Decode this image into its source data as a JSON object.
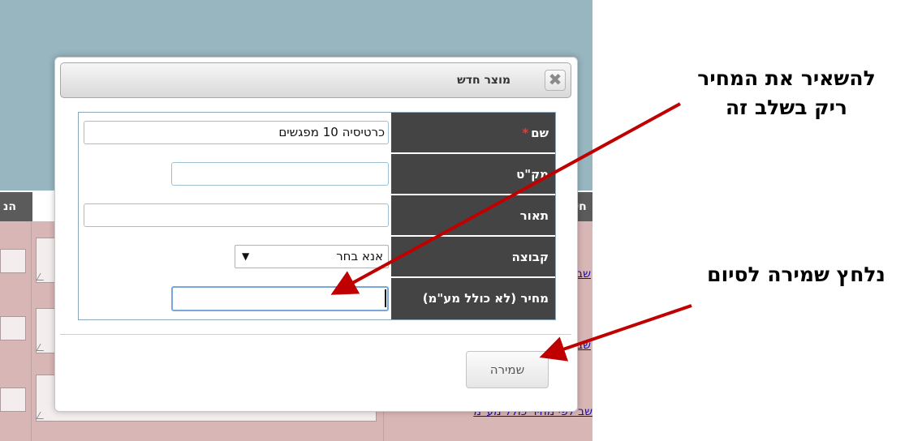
{
  "background": {
    "header_color": "#97b6c0",
    "table_color": "#d9b6b6",
    "column_header_left": "הנ",
    "column_header_right": "חי",
    "links": [
      "שב",
      "שב",
      "שב לפי מחיר כולל מע\"מ"
    ]
  },
  "dialog": {
    "title": "מוצר חדש",
    "close_icon": "close-icon",
    "fields": {
      "name": {
        "label": "שם",
        "required_mark": "*",
        "value": "כרטיסיה 10 מפגשים"
      },
      "sku": {
        "label": "מק\"ט",
        "value": ""
      },
      "description": {
        "label": "תאור",
        "value": ""
      },
      "group": {
        "label": "קבוצה",
        "selected": "אנא בחר",
        "arrow": "▼"
      },
      "price": {
        "label": "מחיר (לא כולל מע\"מ)",
        "value": ""
      }
    },
    "save_label": "שמירה"
  },
  "annotations": {
    "leave_price_empty_line1": "להשאיר את המחיר",
    "leave_price_empty_line2": "ריק בשלב זה",
    "click_save": "נלחץ שמירה לסיום",
    "arrow_color": "#c00000"
  }
}
